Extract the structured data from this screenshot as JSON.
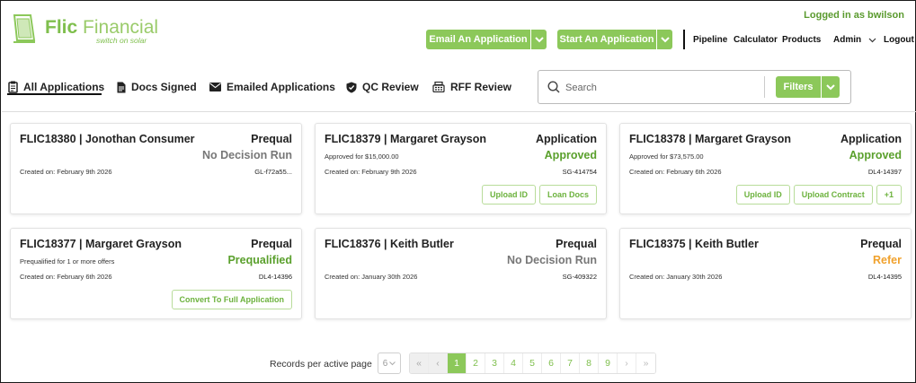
{
  "brand": {
    "name_bold": "Flic",
    "name_light": "Financial",
    "tagline": "switch on solar",
    "color": "#7fbf4d"
  },
  "header": {
    "logged_in": "Logged in as bwilson",
    "email_app_label": "Email An Application",
    "start_app_label": "Start An Application",
    "nav": {
      "pipeline": "Pipeline",
      "calculator": "Calculator",
      "products": "Products",
      "admin": "Admin",
      "logout": "Logout"
    }
  },
  "tabs": [
    {
      "label": "All Applications",
      "icon": "clipboard-icon",
      "active": true
    },
    {
      "label": "Docs Signed",
      "icon": "document-icon",
      "active": false
    },
    {
      "label": "Emailed Applications",
      "icon": "envelope-icon",
      "active": false
    },
    {
      "label": "QC Review",
      "icon": "shield-check-icon",
      "active": false
    },
    {
      "label": "RFF Review",
      "icon": "cash-register-icon",
      "active": false
    }
  ],
  "search": {
    "placeholder": "Search",
    "value": "",
    "filters_label": "Filters"
  },
  "cards": [
    {
      "id": "FLIC18380",
      "name": "Jonothan Consumer",
      "type": "Prequal",
      "status": "No Decision Run",
      "status_color": "gray",
      "note": "",
      "created": "Created on: February 9th 2026",
      "ref": "GL-f72a55...",
      "actions": []
    },
    {
      "id": "FLIC18379",
      "name": "Margaret Grayson",
      "type": "Application",
      "status": "Approved",
      "status_color": "green",
      "note": "Approved for $15,000.00",
      "created": "Created on: February 9th 2026",
      "ref": "SG-414754",
      "actions": [
        "Upload ID",
        "Loan Docs"
      ]
    },
    {
      "id": "FLIC18378",
      "name": "Margaret Grayson",
      "type": "Application",
      "status": "Approved",
      "status_color": "green",
      "note": "Approved for $73,575.00",
      "created": "Created on: February 6th 2026",
      "ref": "DL4-14397",
      "actions": [
        "Upload ID",
        "Upload Contract",
        "+1"
      ]
    },
    {
      "id": "FLIC18377",
      "name": "Margaret Grayson",
      "type": "Prequal",
      "status": "Prequalified",
      "status_color": "green",
      "note": "Prequalified for 1 or more offers",
      "created": "Created on: February 6th 2026",
      "ref": "DL4-14396",
      "actions": [
        "Convert To Full Application"
      ]
    },
    {
      "id": "FLIC18376",
      "name": "Keith Butler",
      "type": "Prequal",
      "status": "No Decision Run",
      "status_color": "gray",
      "note": "",
      "created": "Created on: January 30th 2026",
      "ref": "SG-409322",
      "actions": []
    },
    {
      "id": "FLIC18375",
      "name": "Keith Butler",
      "type": "Prequal",
      "status": "Refer",
      "status_color": "orange",
      "note": "",
      "created": "Created on: January 30th 2026",
      "ref": "DL4-14395",
      "actions": []
    }
  ],
  "pagination": {
    "records_label": "Records per active page",
    "per_page": "6",
    "first": "«",
    "prev": "‹",
    "pages": [
      "1",
      "2",
      "3",
      "4",
      "5",
      "6",
      "7",
      "8",
      "9"
    ],
    "current_page": "1",
    "next": "›",
    "last": "»"
  },
  "colors": {
    "accent": "#8cc85a",
    "approved": "#5aa02c",
    "refer": "#f0a12c",
    "no_decision": "#777777"
  }
}
